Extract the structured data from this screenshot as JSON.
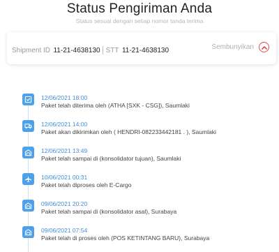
{
  "header": {
    "title": "Status Pengiriman Anda",
    "subtitle": "Status sesuai dengan setiap nomor tanda terima"
  },
  "shipment": {
    "id_label": "Shipment ID",
    "id_value": "11-21-4638130",
    "stt_label": "STT",
    "stt_value": "11-21-4638130",
    "hide_label": "Sembunyikan",
    "hide_icon": "chevron-up-icon",
    "accent_color": "#e5484d"
  },
  "timeline": {
    "accent_color": "#4ea0e8",
    "events": [
      {
        "date": "12/06/2021 18:00",
        "text": "Paket telah diterima oleh (ATHA [SXK - CSG]), Saumlaki",
        "icon": "check-box-icon"
      },
      {
        "date": "12/06/2021 14:00",
        "text": "Paket akan dikirimkan oleh ( HENDRI-082233442181 . ), Saumlaki",
        "icon": "truck-icon"
      },
      {
        "date": "12/06/2021 13:49",
        "text": "Paket telah sampai di (konsolidator tujuan), Saumlaki",
        "icon": "warehouse-icon"
      },
      {
        "date": "10/06/2021 00:31",
        "text": "Paket telah diproses oleh E-Cargo",
        "icon": "airplane-icon"
      },
      {
        "date": "09/06/2021 20:20",
        "text": "Paket telah sampai di (konsolidator asal), Surabaya",
        "icon": "warehouse-icon"
      },
      {
        "date": "09/06/2021 07:54",
        "text": "Paket telah di proses oleh (POS KETINTANG BARU), Surabaya",
        "icon": "warehouse-icon"
      }
    ]
  }
}
